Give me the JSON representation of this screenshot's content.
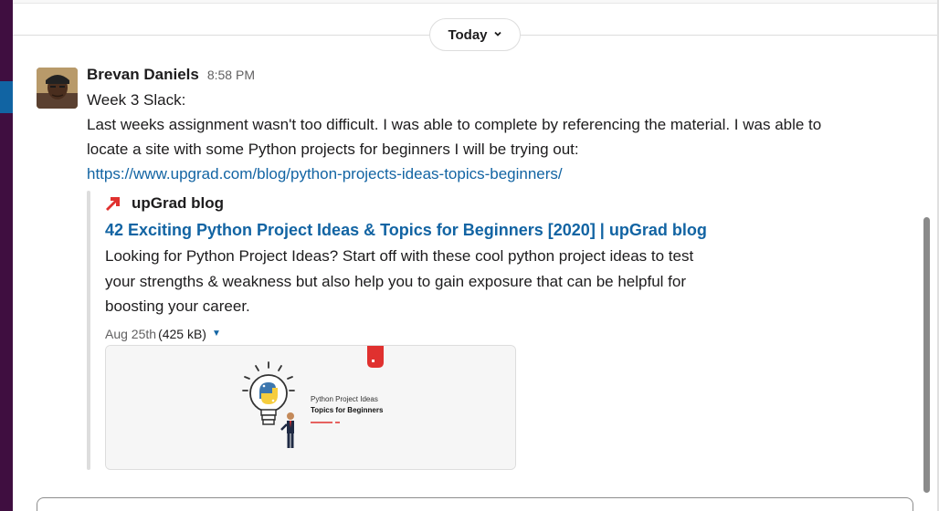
{
  "day_divider": {
    "label": "Today"
  },
  "message": {
    "author": "Brevan Daniels",
    "time": "8:58 PM",
    "lines": [
      "Week 3 Slack:",
      "Last weeks assignment wasn't too difficult. I was able to complete by referencing the material. I was able to",
      "locate a site with some Python projects for beginners I will be trying out:"
    ],
    "link": "https://www.upgrad.com/blog/python-projects-ideas-topics-beginners/"
  },
  "unfurl": {
    "site_name": "upGrad blog",
    "title": "42 Exciting Python Project Ideas & Topics for Beginners [2020] | upGrad blog",
    "description_lines": [
      "Looking for Python Project Ideas? Start off with these cool python project ideas to test",
      "your strengths & weakness but also help you to gain exposure that can be helpful for",
      "boosting your career."
    ],
    "date": "Aug 25th",
    "size": "(425 kB)",
    "preview": {
      "line1": "Python Project Ideas",
      "line2": "Topics for Beginners"
    }
  },
  "colors": {
    "sidebar": "#3f0e40",
    "sidebar_active": "#1164a3",
    "link": "#1264a3",
    "brand_red": "#e0312f"
  },
  "icons": {
    "day_chevron": "chevron-down-icon",
    "site_icon": "upgrad-logo-icon",
    "meta_caret": "caret-down-icon"
  }
}
